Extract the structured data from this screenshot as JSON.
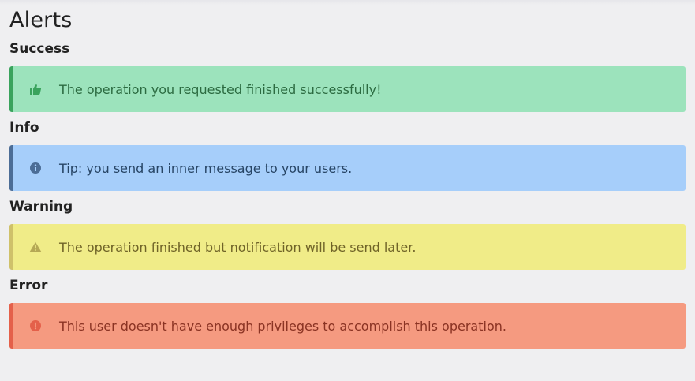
{
  "page": {
    "title": "Alerts"
  },
  "sections": {
    "success": {
      "heading": "Success",
      "message": "The operation you requested finished successfully!",
      "icon": "thumbs-up-icon",
      "color": "#9ce3bc",
      "accent": "#3aa35d"
    },
    "info": {
      "heading": "Info",
      "message": "Tip: you send an inner message to your users.",
      "icon": "info-circle-icon",
      "color": "#a6cefa",
      "accent": "#4c6d96"
    },
    "warning": {
      "heading": "Warning",
      "message": "The operation finished but notification will be send later.",
      "icon": "warning-triangle-icon",
      "color": "#f0ec88",
      "accent": "#cfc16a"
    },
    "error": {
      "heading": "Error",
      "message": "This user doesn't have enough privileges to accomplish this operation.",
      "icon": "exclamation-circle-icon",
      "color": "#f59a80",
      "accent": "#e4604a"
    }
  }
}
